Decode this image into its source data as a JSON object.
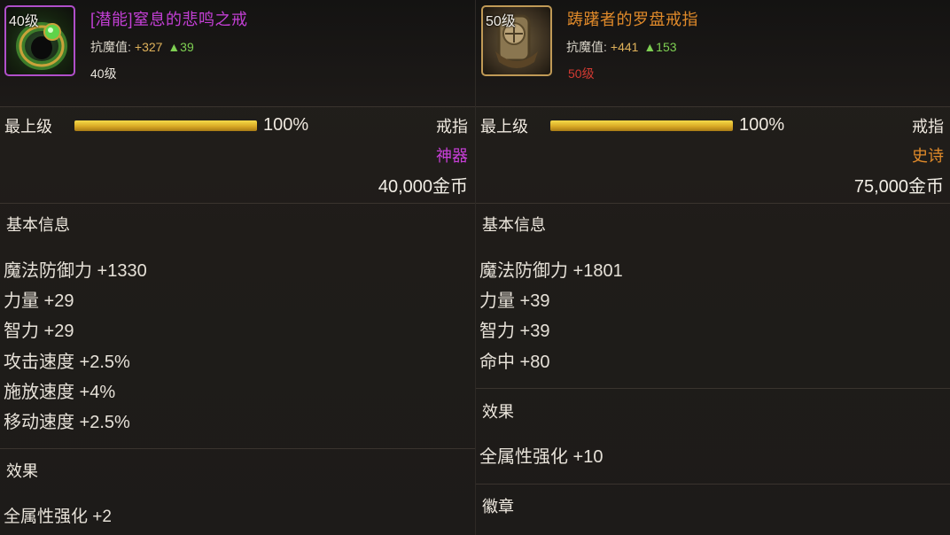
{
  "left": {
    "level_badge": "40级",
    "name": "[潜能]窒息的悲鸣之戒",
    "resist_label": "抗魔值:",
    "resist_value": "+327",
    "resist_up": "▲39",
    "req_level": "40级",
    "tier": "最上级",
    "progress_pct": 100,
    "progress_text": "100%",
    "slot": "戒指",
    "rarity": "神器",
    "price": "40,000金币",
    "basic_title": "基本信息",
    "stats": [
      "魔法防御力 +1330",
      "力量 +29",
      "智力 +29",
      "攻击速度 +2.5%",
      "施放速度 +4%",
      "移动速度 +2.5%"
    ],
    "effect_title": "效果",
    "effects": [
      "全属性强化 +2"
    ],
    "icon": "ring-icon"
  },
  "right": {
    "level_badge": "50级",
    "name": "踌躇者的罗盘戒指",
    "resist_label": "抗魔值:",
    "resist_value": "+441",
    "resist_up": "▲153",
    "req_level": "50级",
    "tier": "最上级",
    "progress_pct": 100,
    "progress_text": "100%",
    "slot": "戒指",
    "rarity": "史诗",
    "price": "75,000金币",
    "basic_title": "基本信息",
    "stats": [
      "魔法防御力 +1801",
      "力量 +39",
      "智力 +39",
      "命中 +80"
    ],
    "effect_title": "效果",
    "effects": [
      "全属性强化 +10"
    ],
    "emblem_title": "徽章",
    "icon": "compass-ring-icon"
  },
  "colors": {
    "artifact": "#c83fd8",
    "epic": "#e08a2a",
    "level_unmet": "#d23a32",
    "increase": "#7ecf52"
  }
}
